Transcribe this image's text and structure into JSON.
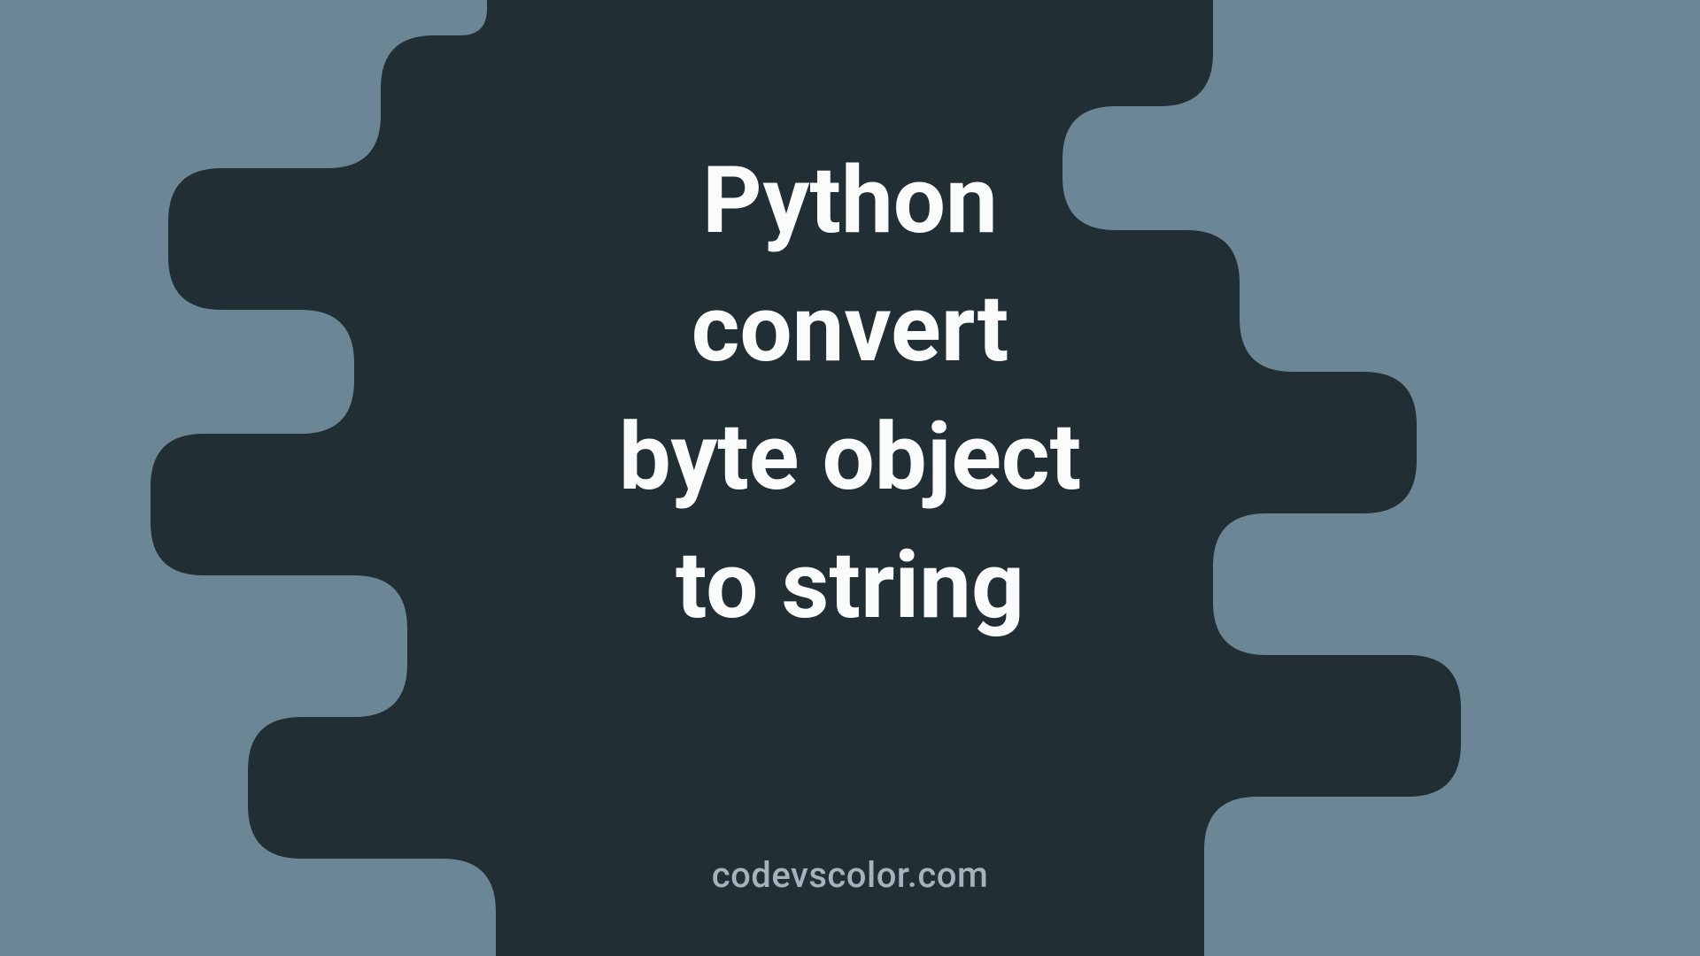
{
  "title": {
    "line1": "Python",
    "line2": "convert",
    "line3": "byte object",
    "line4": "to string"
  },
  "watermark": "codevscolor.com",
  "colors": {
    "background": "#6b8694",
    "blob": "#212e34",
    "titleText": "#fafbfb",
    "watermarkText": "#a4b4bc"
  }
}
